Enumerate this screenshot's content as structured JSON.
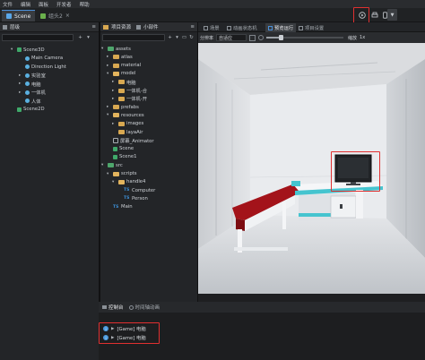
{
  "menu": [
    "文件",
    "编辑",
    "面板",
    "开发者",
    "帮助"
  ],
  "tabs": [
    {
      "label": "Scene",
      "active": true
    },
    {
      "label": "组头2",
      "active": false
    }
  ],
  "hierarchy": {
    "title": "层级",
    "items": [
      {
        "label": "Scene3D",
        "type": "scene",
        "level": 0,
        "caret": "▾"
      },
      {
        "label": "Main Camera",
        "type": "node",
        "level": 1,
        "caret": ""
      },
      {
        "label": "Direction Light",
        "type": "node",
        "level": 1,
        "caret": ""
      },
      {
        "label": "实验室",
        "type": "node",
        "level": 1,
        "caret": "▸"
      },
      {
        "label": "电脑",
        "type": "node",
        "level": 1,
        "caret": "▸"
      },
      {
        "label": "一体机",
        "type": "node",
        "level": 1,
        "caret": "▸"
      },
      {
        "label": "人体",
        "type": "node",
        "level": 1,
        "caret": ""
      },
      {
        "label": "Scene2D",
        "type": "scene",
        "level": 0,
        "caret": ""
      }
    ]
  },
  "assets": {
    "tab_project": "项目资源",
    "tab_widgets": "小部件",
    "items": [
      {
        "label": "assets",
        "type": "folder-green",
        "level": 0,
        "caret": "▾"
      },
      {
        "label": "atlas",
        "type": "folder",
        "level": 1,
        "caret": "▸"
      },
      {
        "label": "material",
        "type": "folder",
        "level": 1,
        "caret": "▸"
      },
      {
        "label": "model",
        "type": "folder-open",
        "level": 1,
        "caret": "▾"
      },
      {
        "label": "电脑",
        "type": "folder",
        "level": 2,
        "caret": "▸"
      },
      {
        "label": "一体机-合",
        "type": "folder",
        "level": 2,
        "caret": "▸"
      },
      {
        "label": "一体机-开",
        "type": "folder",
        "level": 2,
        "caret": "▸"
      },
      {
        "label": "prefabs",
        "type": "folder",
        "level": 1,
        "caret": "▸"
      },
      {
        "label": "resources",
        "type": "folder-open",
        "level": 1,
        "caret": "▾"
      },
      {
        "label": "images",
        "type": "folder",
        "level": 2,
        "caret": "▸"
      },
      {
        "label": "layaAir",
        "type": "folder",
        "level": 2,
        "caret": ""
      },
      {
        "label": "屏幕_Animator",
        "type": "anim",
        "level": 1,
        "caret": ""
      },
      {
        "label": "Scene",
        "type": "scene",
        "level": 1,
        "caret": ""
      },
      {
        "label": "Scene1",
        "type": "scene",
        "level": 1,
        "caret": ""
      },
      {
        "label": "src",
        "type": "folder-green",
        "level": 0,
        "caret": "▾"
      },
      {
        "label": "scripts",
        "type": "folder-open",
        "level": 1,
        "caret": "▾"
      },
      {
        "label": "handle4",
        "type": "folder-open",
        "level": 2,
        "caret": "▾"
      },
      {
        "label": "Computer",
        "type": "ts",
        "level": 3,
        "caret": ""
      },
      {
        "label": "Person",
        "type": "ts",
        "level": 3,
        "caret": ""
      },
      {
        "label": "Main",
        "type": "ts",
        "level": 1,
        "caret": ""
      }
    ]
  },
  "viewtabs": [
    {
      "label": "场景",
      "active": false
    },
    {
      "label": "动画状态机",
      "active": false
    },
    {
      "label": "预览运行",
      "active": true
    },
    {
      "label": "项目设置",
      "active": false
    }
  ],
  "preview_toolbar": {
    "resolution_label": "分辨率",
    "resolution_value": "自适应",
    "zoom_label": "缩放",
    "zoom_value": "1x"
  },
  "bottom": {
    "tab_console": "控制台",
    "tab_timeline": "时间轴动画",
    "logs": [
      "[Game] 电脑",
      "[Game] 电脑"
    ]
  },
  "colors": {
    "accent": "#4a90d9",
    "highlight": "#e03030",
    "bench": "#a3131a",
    "table_trim": "#45c4cf"
  }
}
